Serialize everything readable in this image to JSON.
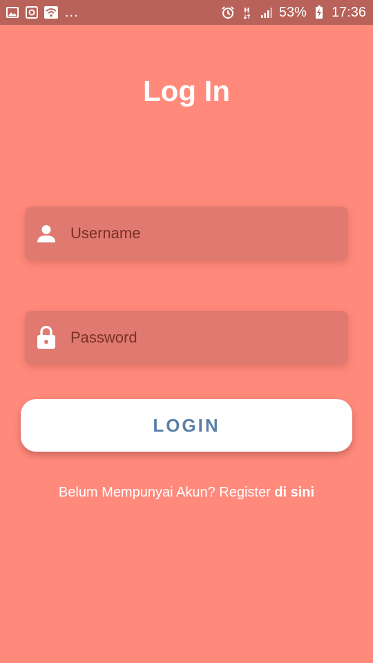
{
  "status_bar": {
    "icons_left": [
      "image-icon",
      "screenshot-icon",
      "wifi-icon"
    ],
    "more": "...",
    "icons_right": [
      "alarm-icon",
      "h-plus-data-icon",
      "signal-icon",
      "battery-charging-icon"
    ],
    "battery": "53%",
    "time": "17:36"
  },
  "page": {
    "title": "Log In"
  },
  "form": {
    "username_placeholder": "Username",
    "password_placeholder": "Password",
    "login_label": "LOGIN"
  },
  "footer": {
    "prompt": "Belum Mempunyai Akun? Register ",
    "link": "di sini"
  },
  "colors": {
    "background": "#ff8a7c",
    "status_bar": "#b8625a",
    "field_background": "#e07a70",
    "button_text": "#5a7fa8",
    "text": "#ffffff"
  }
}
